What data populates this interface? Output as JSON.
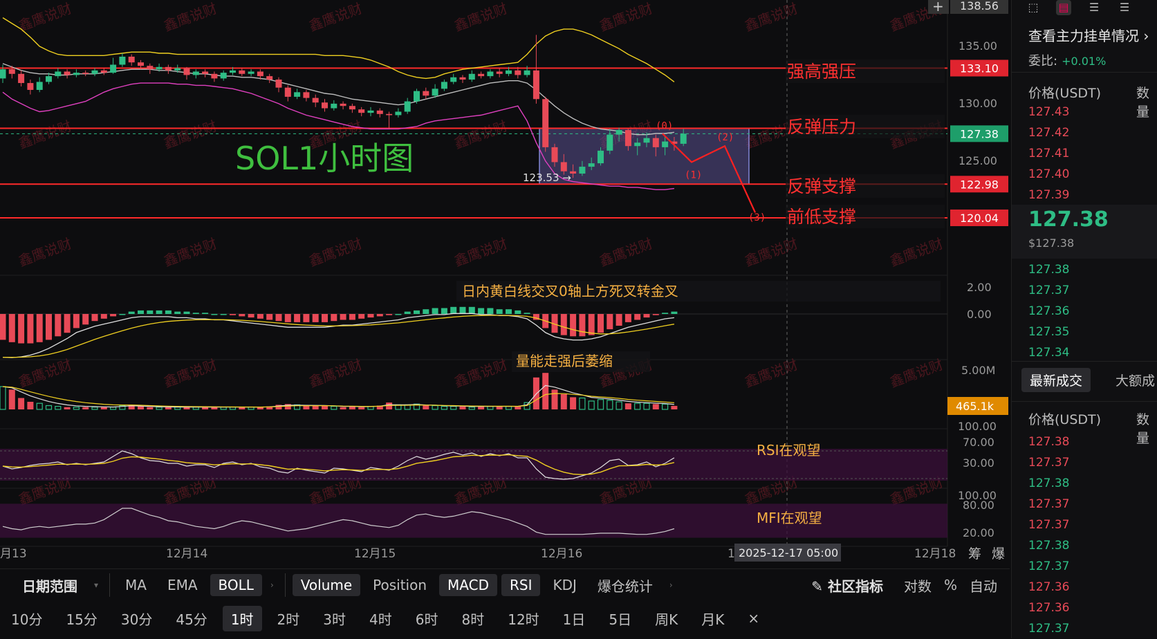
{
  "chart_title": "SOL1小时图",
  "annotations": {
    "strong_resistance": "强高强压",
    "rebound_resistance": "反弹压力",
    "rebound_support": "反弹支撑",
    "prior_low_support": "前低支撑",
    "low_marker": "123.53 →",
    "macd_note": "日内黄白线交叉0轴上方死叉转金叉",
    "volume_note": "量能走强后萎缩",
    "rsi_note": "RSI在观望",
    "mfi_note": "MFI在观望",
    "wave_labels": [
      "(0)",
      "(1)",
      "(2)",
      "(3)"
    ],
    "watermark": "鑫鹰说财"
  },
  "price_tags": {
    "top": "138.56",
    "line_133": "133.10",
    "current": "127.38",
    "line_123": "122.98",
    "line_120": "120.04",
    "volume": "465.1k"
  },
  "cursor_date": "2025-12-17 05:00",
  "axis_right_labels": {
    "price": [
      "135.00",
      "130.00",
      "125.00"
    ],
    "macd": [
      "2.00",
      "0.00"
    ],
    "volume": [
      "5.00M"
    ],
    "rsi": [
      "100.00",
      "70.00",
      "30.00"
    ],
    "mfi": [
      "100.00",
      "80.00",
      "20.00"
    ]
  },
  "date_axis": [
    "月13",
    "12月14",
    "12月15",
    "12月16",
    "12月17",
    "12月18"
  ],
  "date_axis_right_icons": [
    "筹",
    "爆"
  ],
  "colors": {
    "up": "#2ebd85",
    "down": "#e84a57",
    "resistance_line": "#ff2a2a",
    "boll_mid": "#bdbdbd",
    "boll_upper": "#f0d020",
    "boll_lower": "#e040c0",
    "annotation_text": "#ff3030",
    "title_green": "#3fbf3f",
    "note_orange": "#f5b042",
    "box_fill": "#6a5fae"
  },
  "toolbar": {
    "row1": [
      "日期范围",
      "MA",
      "EMA",
      "BOLL",
      "Volume",
      "Position",
      "MACD",
      "RSI",
      "KDJ",
      "爆仓统计"
    ],
    "row1_right": [
      "社区指标",
      "对数",
      "%",
      "自动"
    ],
    "intervals": [
      "10分",
      "15分",
      "30分",
      "45分",
      "1时",
      "2时",
      "3时",
      "4时",
      "6时",
      "8时",
      "12时",
      "1日",
      "5日",
      "周K",
      "月K"
    ],
    "active_interval": "1时",
    "close_icon": "×"
  },
  "sidebar": {
    "title": "查看主力挂单情况",
    "ratio_label": "委比:",
    "ratio_value": "+0.01%",
    "col_price": "价格(USDT)",
    "col_qty": "数量",
    "asks": [
      "127.43",
      "127.42",
      "127.41",
      "127.40",
      "127.39"
    ],
    "mid_price": "127.38",
    "mid_price_usd": "$127.38",
    "bids": [
      "127.38",
      "127.37",
      "127.36",
      "127.35",
      "127.34"
    ],
    "trades_tab": "最新成交",
    "trades_tab2": "大额成",
    "trades": [
      {
        "price": "127.38",
        "side": "down"
      },
      {
        "price": "127.37",
        "side": "down"
      },
      {
        "price": "127.38",
        "side": "up"
      },
      {
        "price": "127.37",
        "side": "down"
      },
      {
        "price": "127.37",
        "side": "down"
      },
      {
        "price": "127.38",
        "side": "up"
      },
      {
        "price": "127.37",
        "side": "up"
      },
      {
        "price": "127.36",
        "side": "down"
      },
      {
        "price": "127.36",
        "side": "down"
      },
      {
        "price": "127.37",
        "side": "up"
      }
    ]
  },
  "chart_data": {
    "type": "candlestick",
    "title": "SOL1小时图",
    "ylim": [
      119.0,
      138.5
    ],
    "horizontal_levels": [
      133.1,
      127.85,
      122.98,
      120.04
    ],
    "current_price": 127.38,
    "candles": [
      {
        "o": 132.2,
        "c": 133.0,
        "h": 133.4,
        "l": 131.8
      },
      {
        "o": 133.0,
        "c": 132.6,
        "h": 133.3,
        "l": 132.2
      },
      {
        "o": 132.6,
        "c": 131.8,
        "h": 132.9,
        "l": 131.5
      },
      {
        "o": 131.8,
        "c": 131.2,
        "h": 132.1,
        "l": 130.8
      },
      {
        "o": 131.2,
        "c": 131.9,
        "h": 132.3,
        "l": 131.0
      },
      {
        "o": 131.9,
        "c": 132.4,
        "h": 132.7,
        "l": 131.7
      },
      {
        "o": 132.4,
        "c": 132.8,
        "h": 133.1,
        "l": 132.2
      },
      {
        "o": 132.8,
        "c": 132.5,
        "h": 133.0,
        "l": 132.2
      },
      {
        "o": 132.5,
        "c": 132.7,
        "h": 133.0,
        "l": 132.3
      },
      {
        "o": 132.7,
        "c": 132.6,
        "h": 132.9,
        "l": 132.4
      },
      {
        "o": 132.6,
        "c": 132.9,
        "h": 133.1,
        "l": 132.4
      },
      {
        "o": 132.9,
        "c": 132.7,
        "h": 133.1,
        "l": 132.5
      },
      {
        "o": 132.7,
        "c": 133.4,
        "h": 134.0,
        "l": 132.6
      },
      {
        "o": 133.4,
        "c": 134.1,
        "h": 134.4,
        "l": 133.2
      },
      {
        "o": 134.1,
        "c": 133.6,
        "h": 134.3,
        "l": 133.3
      },
      {
        "o": 133.6,
        "c": 133.3,
        "h": 133.8,
        "l": 133.0
      },
      {
        "o": 133.3,
        "c": 133.0,
        "h": 133.5,
        "l": 132.6
      },
      {
        "o": 133.0,
        "c": 133.2,
        "h": 133.5,
        "l": 132.8
      },
      {
        "o": 133.2,
        "c": 132.9,
        "h": 133.4,
        "l": 132.6
      },
      {
        "o": 132.9,
        "c": 133.1,
        "h": 133.4,
        "l": 132.7
      },
      {
        "o": 133.1,
        "c": 132.5,
        "h": 133.2,
        "l": 132.1
      },
      {
        "o": 132.5,
        "c": 132.8,
        "h": 133.0,
        "l": 132.2
      },
      {
        "o": 132.8,
        "c": 132.6,
        "h": 133.0,
        "l": 132.3
      },
      {
        "o": 132.6,
        "c": 132.2,
        "h": 132.8,
        "l": 131.9
      },
      {
        "o": 132.2,
        "c": 132.7,
        "h": 132.9,
        "l": 132.0
      },
      {
        "o": 132.7,
        "c": 132.9,
        "h": 133.2,
        "l": 132.5
      },
      {
        "o": 132.9,
        "c": 132.6,
        "h": 133.1,
        "l": 132.4
      },
      {
        "o": 132.6,
        "c": 132.8,
        "h": 133.0,
        "l": 132.4
      },
      {
        "o": 132.8,
        "c": 132.4,
        "h": 133.0,
        "l": 132.1
      },
      {
        "o": 132.4,
        "c": 132.1,
        "h": 132.6,
        "l": 131.8
      },
      {
        "o": 132.1,
        "c": 131.4,
        "h": 132.3,
        "l": 131.0
      },
      {
        "o": 131.4,
        "c": 130.6,
        "h": 131.6,
        "l": 130.2
      },
      {
        "o": 130.6,
        "c": 131.0,
        "h": 131.3,
        "l": 130.4
      },
      {
        "o": 131.0,
        "c": 130.5,
        "h": 131.2,
        "l": 130.2
      },
      {
        "o": 130.5,
        "c": 130.1,
        "h": 130.8,
        "l": 129.7
      },
      {
        "o": 130.1,
        "c": 129.6,
        "h": 130.4,
        "l": 129.3
      },
      {
        "o": 129.6,
        "c": 130.0,
        "h": 130.3,
        "l": 129.4
      },
      {
        "o": 130.0,
        "c": 129.8,
        "h": 130.2,
        "l": 129.5
      },
      {
        "o": 129.8,
        "c": 129.5,
        "h": 130.0,
        "l": 129.2
      },
      {
        "o": 129.5,
        "c": 129.2,
        "h": 129.7,
        "l": 128.9
      },
      {
        "o": 129.2,
        "c": 129.4,
        "h": 129.7,
        "l": 128.9
      },
      {
        "o": 129.4,
        "c": 129.1,
        "h": 129.6,
        "l": 128.8
      },
      {
        "o": 129.1,
        "c": 129.0,
        "h": 129.3,
        "l": 127.8
      },
      {
        "o": 129.0,
        "c": 129.3,
        "h": 129.6,
        "l": 128.8
      },
      {
        "o": 129.3,
        "c": 130.2,
        "h": 130.5,
        "l": 129.1
      },
      {
        "o": 130.2,
        "c": 131.1,
        "h": 131.3,
        "l": 130.0
      },
      {
        "o": 131.1,
        "c": 130.7,
        "h": 131.4,
        "l": 130.4
      },
      {
        "o": 130.7,
        "c": 131.3,
        "h": 131.7,
        "l": 130.5
      },
      {
        "o": 131.3,
        "c": 131.9,
        "h": 132.1,
        "l": 131.1
      },
      {
        "o": 131.9,
        "c": 132.3,
        "h": 132.6,
        "l": 131.7
      },
      {
        "o": 132.3,
        "c": 132.1,
        "h": 132.5,
        "l": 131.8
      },
      {
        "o": 132.1,
        "c": 132.6,
        "h": 132.9,
        "l": 131.9
      },
      {
        "o": 132.6,
        "c": 132.4,
        "h": 132.8,
        "l": 132.2
      },
      {
        "o": 132.4,
        "c": 132.8,
        "h": 133.0,
        "l": 132.2
      },
      {
        "o": 132.8,
        "c": 132.6,
        "h": 133.1,
        "l": 132.3
      },
      {
        "o": 132.6,
        "c": 132.9,
        "h": 133.2,
        "l": 132.4
      },
      {
        "o": 132.9,
        "c": 132.5,
        "h": 133.2,
        "l": 132.2
      },
      {
        "o": 132.5,
        "c": 132.9,
        "h": 133.3,
        "l": 132.3
      },
      {
        "o": 132.9,
        "c": 130.4,
        "h": 136.0,
        "l": 130.0
      },
      {
        "o": 130.4,
        "c": 126.2,
        "h": 130.6,
        "l": 125.8
      },
      {
        "o": 126.2,
        "c": 124.9,
        "h": 126.5,
        "l": 124.5
      },
      {
        "o": 124.9,
        "c": 124.1,
        "h": 125.6,
        "l": 123.8
      },
      {
        "o": 124.1,
        "c": 123.9,
        "h": 124.7,
        "l": 123.53
      },
      {
        "o": 123.9,
        "c": 124.5,
        "h": 125.0,
        "l": 123.7
      },
      {
        "o": 124.5,
        "c": 124.8,
        "h": 125.3,
        "l": 124.2
      },
      {
        "o": 124.8,
        "c": 125.9,
        "h": 126.2,
        "l": 124.6
      },
      {
        "o": 125.9,
        "c": 127.3,
        "h": 127.8,
        "l": 125.6
      },
      {
        "o": 127.3,
        "c": 127.7,
        "h": 127.9,
        "l": 126.7
      },
      {
        "o": 127.7,
        "c": 126.3,
        "h": 127.8,
        "l": 125.9
      },
      {
        "o": 126.3,
        "c": 126.6,
        "h": 127.0,
        "l": 125.5
      },
      {
        "o": 126.6,
        "c": 127.0,
        "h": 127.5,
        "l": 126.2
      },
      {
        "o": 127.0,
        "c": 126.2,
        "h": 127.3,
        "l": 125.4
      },
      {
        "o": 126.2,
        "c": 126.7,
        "h": 127.2,
        "l": 125.5
      },
      {
        "o": 126.7,
        "c": 126.5,
        "h": 127.1,
        "l": 125.9
      },
      {
        "o": 126.5,
        "c": 127.38,
        "h": 127.8,
        "l": 126.3
      }
    ],
    "boll_mid": [
      133.5,
      133.2,
      132.9,
      132.7,
      132.6,
      132.6,
      132.5,
      132.5,
      132.6,
      132.6,
      132.6,
      132.7,
      132.8,
      132.9,
      133.0,
      133.0,
      133.0,
      132.9,
      132.9,
      132.8,
      132.7,
      132.6,
      132.6,
      132.5,
      132.4,
      132.4,
      132.3,
      132.3,
      132.2,
      132.1,
      131.9,
      131.7,
      131.5,
      131.3,
      131.1,
      130.9,
      130.8,
      130.6,
      130.4,
      130.3,
      130.2,
      130.1,
      130.0,
      129.9,
      130.0,
      130.2,
      130.4,
      130.6,
      130.8,
      131.0,
      131.2,
      131.4,
      131.6,
      131.8,
      131.9,
      132.0,
      132.0,
      131.8,
      131.2,
      130.5,
      129.8,
      129.2,
      128.7,
      128.3,
      128.0,
      127.8,
      127.7,
      127.6,
      127.4,
      127.3,
      127.3,
      127.4,
      127.4,
      127.5
    ],
    "boll_upper": [
      137.5,
      137.0,
      136.5,
      135.8,
      135.0,
      134.6,
      134.3,
      134.2,
      134.2,
      134.2,
      134.2,
      134.2,
      134.3,
      134.4,
      134.5,
      134.5,
      134.5,
      134.4,
      134.4,
      134.3,
      134.3,
      134.3,
      134.3,
      134.3,
      134.3,
      134.3,
      134.3,
      134.3,
      134.3,
      134.3,
      134.3,
      134.3,
      134.3,
      134.3,
      134.3,
      134.2,
      134.2,
      134.2,
      134.1,
      134.0,
      133.8,
      133.5,
      133.2,
      132.8,
      132.5,
      132.3,
      132.2,
      132.3,
      132.6,
      132.8,
      133.0,
      133.1,
      133.2,
      133.3,
      133.4,
      133.5,
      133.6,
      134.3,
      135.2,
      135.9,
      136.3,
      136.5,
      136.5,
      136.3,
      136.0,
      135.6,
      135.2,
      134.8,
      134.3,
      133.9,
      133.5,
      133.0,
      132.5,
      131.9
    ],
    "boll_lower": [
      131.0,
      130.4,
      130.0,
      129.6,
      129.3,
      129.4,
      129.6,
      129.8,
      130.0,
      130.2,
      130.6,
      131.0,
      131.3,
      131.5,
      131.7,
      131.8,
      131.8,
      131.8,
      131.8,
      131.7,
      131.7,
      131.6,
      131.6,
      131.5,
      131.4,
      131.3,
      131.1,
      130.9,
      130.6,
      130.3,
      130.0,
      129.6,
      129.3,
      129.0,
      128.8,
      128.6,
      128.4,
      128.2,
      128.0,
      127.9,
      127.8,
      127.8,
      127.8,
      127.8,
      127.9,
      128.0,
      128.3,
      128.5,
      128.6,
      128.7,
      128.8,
      128.9,
      129.0,
      129.2,
      129.4,
      129.6,
      129.8,
      128.5,
      126.6,
      125.0,
      123.9,
      123.4,
      123.2,
      123.1,
      123.0,
      122.9,
      122.8,
      122.8,
      122.7,
      122.7,
      122.6,
      122.5,
      122.5,
      122.6
    ],
    "macd_hist": [
      -2.2,
      -2.4,
      -2.5,
      -2.5,
      -2.4,
      -2.2,
      -1.9,
      -1.6,
      -1.2,
      -0.9,
      -0.6,
      -0.4,
      -0.2,
      0.0,
      0.2,
      0.3,
      0.3,
      0.3,
      0.3,
      0.2,
      0.2,
      0.1,
      0.1,
      0.0,
      0.0,
      -0.1,
      -0.2,
      -0.3,
      -0.4,
      -0.5,
      -0.6,
      -0.7,
      -0.7,
      -0.7,
      -0.7,
      -0.7,
      -0.6,
      -0.5,
      -0.5,
      -0.4,
      -0.3,
      -0.2,
      -0.1,
      0.0,
      0.2,
      0.3,
      0.4,
      0.5,
      0.5,
      0.6,
      0.6,
      0.6,
      0.5,
      0.5,
      0.4,
      0.4,
      0.3,
      0.1,
      -0.5,
      -1.2,
      -1.6,
      -1.8,
      -1.9,
      -1.9,
      -1.8,
      -1.6,
      -1.3,
      -1.0,
      -0.7,
      -0.5,
      -0.3,
      -0.1,
      0.1,
      0.2
    ],
    "volume": [
      3.0,
      2.6,
      1.5,
      1.0,
      0.8,
      0.5,
      0.4,
      0.3,
      0.3,
      0.3,
      0.3,
      0.3,
      0.3,
      0.5,
      0.6,
      0.4,
      0.3,
      0.3,
      0.3,
      0.3,
      0.3,
      0.3,
      0.3,
      0.3,
      0.3,
      0.3,
      0.3,
      0.3,
      0.3,
      0.4,
      0.6,
      0.7,
      0.6,
      0.5,
      0.5,
      0.5,
      0.4,
      0.3,
      0.4,
      0.3,
      0.4,
      0.5,
      0.9,
      0.6,
      0.6,
      0.7,
      0.5,
      0.5,
      0.4,
      0.4,
      0.4,
      0.3,
      0.4,
      0.4,
      0.4,
      0.4,
      0.4,
      0.9,
      4.2,
      4.8,
      2.6,
      2.0,
      1.6,
      1.5,
      1.1,
      1.3,
      1.2,
      1.0,
      0.8,
      0.8,
      0.8,
      0.7,
      0.7,
      0.46
    ],
    "rsi": [
      48,
      44,
      46,
      49,
      51,
      52,
      54,
      50,
      52,
      50,
      52,
      54,
      62,
      70,
      66,
      60,
      56,
      55,
      52,
      52,
      48,
      50,
      50,
      46,
      52,
      54,
      50,
      52,
      47,
      45,
      40,
      38,
      45,
      42,
      40,
      38,
      45,
      44,
      42,
      40,
      46,
      44,
      42,
      48,
      56,
      62,
      58,
      61,
      65,
      68,
      64,
      67,
      62,
      66,
      63,
      66,
      60,
      60,
      44,
      32,
      30,
      29,
      30,
      34,
      38,
      46,
      56,
      58,
      49,
      50,
      54,
      47,
      52,
      60
    ],
    "mfi": [
      40,
      36,
      34,
      38,
      40,
      38,
      40,
      42,
      44,
      44,
      46,
      52,
      62,
      72,
      72,
      66,
      60,
      56,
      50,
      48,
      44,
      40,
      38,
      36,
      40,
      46,
      50,
      48,
      44,
      40,
      36,
      32,
      34,
      36,
      40,
      44,
      48,
      52,
      50,
      46,
      42,
      40,
      38,
      42,
      52,
      60,
      62,
      58,
      56,
      58,
      62,
      66,
      64,
      60,
      56,
      52,
      46,
      40,
      30,
      26,
      26,
      26,
      26,
      26,
      27,
      28,
      28,
      28,
      27,
      26,
      26,
      28,
      31,
      36
    ]
  }
}
